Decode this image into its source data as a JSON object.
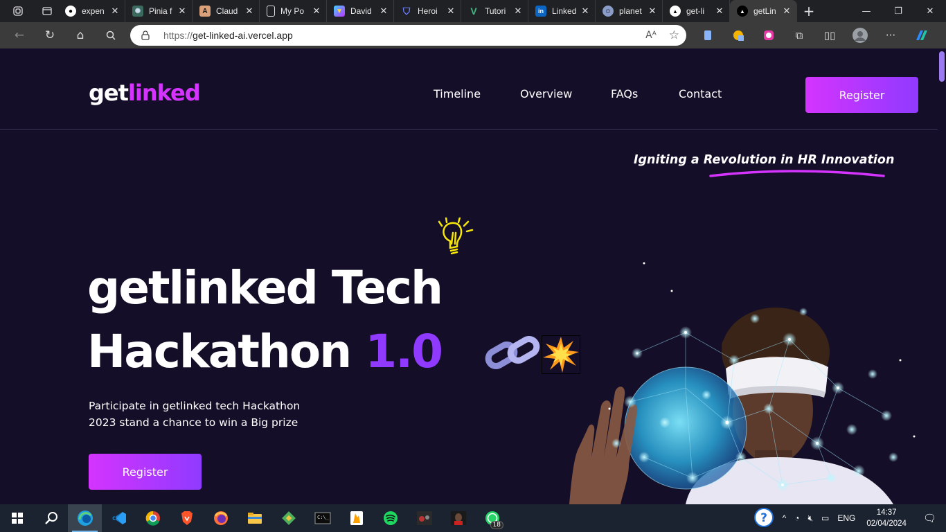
{
  "browser": {
    "tabs": [
      {
        "label": "expen",
        "icon": "github-icon"
      },
      {
        "label": "Pinia f",
        "icon": "openai-icon"
      },
      {
        "label": "Claud",
        "icon": "anthropic-icon"
      },
      {
        "label": "My Po",
        "icon": "document-icon"
      },
      {
        "label": "David",
        "icon": "vite-icon"
      },
      {
        "label": "Heroi",
        "icon": "shield-icon"
      },
      {
        "label": "Tutori",
        "icon": "vue-icon"
      },
      {
        "label": "Linked",
        "icon": "linkedin-icon"
      },
      {
        "label": "planet",
        "icon": "planet-icon"
      },
      {
        "label": "get-li",
        "icon": "vercel-icon"
      },
      {
        "label": "getLin",
        "icon": "vercel-icon"
      }
    ],
    "url_protocol": "https://",
    "url_host": "get-linked-ai.vercel.app"
  },
  "site": {
    "logo_main": "get",
    "logo_accent": "linked",
    "nav": [
      "Timeline",
      "Overview",
      "FAQs",
      "Contact"
    ],
    "register_label": "Register",
    "tagline": "Igniting a Revolution in HR Innovation",
    "title_line1": "getlinked Tech",
    "title_line2": "Hackathon",
    "title_version": "1.0",
    "description": "Participate in getlinked tech Hackathon 2023 stand a chance to win a Big prize",
    "hero_register_label": "Register",
    "colors": {
      "accent_pink": "#d434fe",
      "accent_purple": "#903aff",
      "background": "#150e28"
    }
  },
  "taskbar": {
    "language": "ENG",
    "time": "14:37",
    "date": "02/04/2024",
    "whatsapp_badge": "18"
  }
}
